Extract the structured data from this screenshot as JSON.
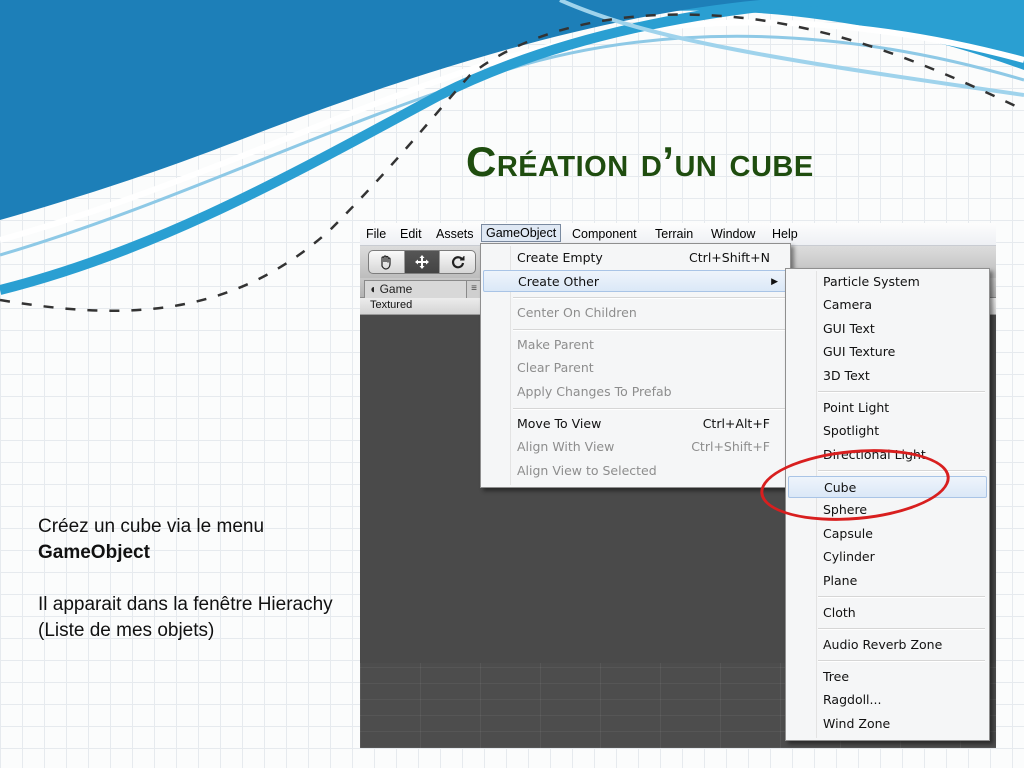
{
  "slide": {
    "title": "Création d’un cube",
    "text_line1": "Créez un cube via le menu",
    "text_bold": "GameObject",
    "text_line2": "Il apparait dans la fenêtre Hierachy (Liste de mes objets)"
  },
  "menubar": {
    "items": [
      "File",
      "Edit",
      "Assets",
      "GameObject",
      "Component",
      "Terrain",
      "Window",
      "Help"
    ],
    "active": "GameObject"
  },
  "editor": {
    "tab_game": "Game",
    "tab_extra": "≡",
    "textured": "Textured",
    "tools": [
      "hand-icon",
      "move-icon",
      "rotate-icon"
    ]
  },
  "gameobject_menu": {
    "create_empty": {
      "label": "Create Empty",
      "shortcut": "Ctrl+Shift+N"
    },
    "create_other": {
      "label": "Create Other",
      "arrow": "▶"
    },
    "center_on_children": "Center On Children",
    "make_parent": "Make Parent",
    "clear_parent": "Clear Parent",
    "apply_changes": "Apply Changes To Prefab",
    "move_to_view": {
      "label": "Move To View",
      "shortcut": "Ctrl+Alt+F"
    },
    "align_with_view": {
      "label": "Align With View",
      "shortcut": "Ctrl+Shift+F"
    },
    "align_view_to_selected": "Align View to Selected"
  },
  "create_other_menu": {
    "items": [
      "Particle System",
      "Camera",
      "GUI Text",
      "GUI Texture",
      "3D Text",
      "Point Light",
      "Spotlight",
      "Directional Light",
      "Cube",
      "Sphere",
      "Capsule",
      "Cylinder",
      "Plane",
      "Cloth",
      "Audio Reverb Zone",
      "Tree",
      "Ragdoll...",
      "Wind Zone"
    ],
    "highlighted": "Cube"
  },
  "colors": {
    "title": "#1f4d0f",
    "highlight_ring": "#d81f1f",
    "viewport": "#4a4a4a"
  }
}
